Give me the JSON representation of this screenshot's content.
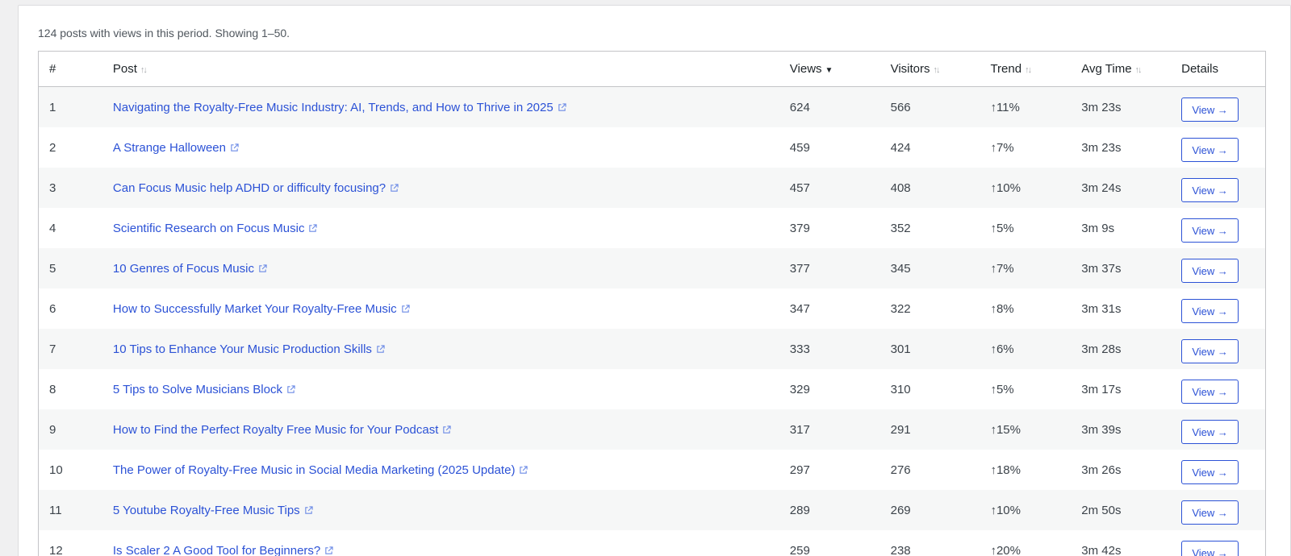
{
  "summary": "124 posts with views in this period. Showing 1–50.",
  "table": {
    "headers": {
      "num": "#",
      "post": "Post",
      "views": "Views",
      "visitors": "Visitors",
      "trend": "Trend",
      "avg_time": "Avg Time",
      "details": "Details"
    },
    "view_label": "View →",
    "rows": [
      {
        "num": "1",
        "title": "Navigating the Royalty-Free Music Industry: AI, Trends, and How to Thrive in 2025",
        "views": "624",
        "visitors": "566",
        "trend": "↑11%",
        "avg": "3m 23s"
      },
      {
        "num": "2",
        "title": "A Strange Halloween",
        "views": "459",
        "visitors": "424",
        "trend": "↑7%",
        "avg": "3m 23s"
      },
      {
        "num": "3",
        "title": "Can Focus Music help ADHD or difficulty focusing?",
        "views": "457",
        "visitors": "408",
        "trend": "↑10%",
        "avg": "3m 24s"
      },
      {
        "num": "4",
        "title": "Scientific Research on Focus Music",
        "views": "379",
        "visitors": "352",
        "trend": "↑5%",
        "avg": "3m 9s"
      },
      {
        "num": "5",
        "title": "10 Genres of Focus Music",
        "views": "377",
        "visitors": "345",
        "trend": "↑7%",
        "avg": "3m 37s"
      },
      {
        "num": "6",
        "title": "How to Successfully Market Your Royalty-Free Music",
        "views": "347",
        "visitors": "322",
        "trend": "↑8%",
        "avg": "3m 31s"
      },
      {
        "num": "7",
        "title": "10 Tips to Enhance Your Music Production Skills",
        "views": "333",
        "visitors": "301",
        "trend": "↑6%",
        "avg": "3m 28s"
      },
      {
        "num": "8",
        "title": "5 Tips to Solve Musicians Block",
        "views": "329",
        "visitors": "310",
        "trend": "↑5%",
        "avg": "3m 17s"
      },
      {
        "num": "9",
        "title": "How to Find the Perfect Royalty Free Music for Your Podcast",
        "views": "317",
        "visitors": "291",
        "trend": "↑15%",
        "avg": "3m 39s"
      },
      {
        "num": "10",
        "title": "The Power of Royalty-Free Music in Social Media Marketing (2025 Update)",
        "views": "297",
        "visitors": "276",
        "trend": "↑18%",
        "avg": "3m 26s"
      },
      {
        "num": "11",
        "title": "5 Youtube Royalty-Free Music Tips",
        "views": "289",
        "visitors": "269",
        "trend": "↑10%",
        "avg": "2m 50s"
      },
      {
        "num": "12",
        "title": "Is Scaler 2 A Good Tool for Beginners?",
        "views": "259",
        "visitors": "238",
        "trend": "↑20%",
        "avg": "3m 42s"
      }
    ]
  },
  "colors": {
    "link": "#2c52d6",
    "stripe": "#f6f7f7",
    "border": "#c3c4c7"
  }
}
